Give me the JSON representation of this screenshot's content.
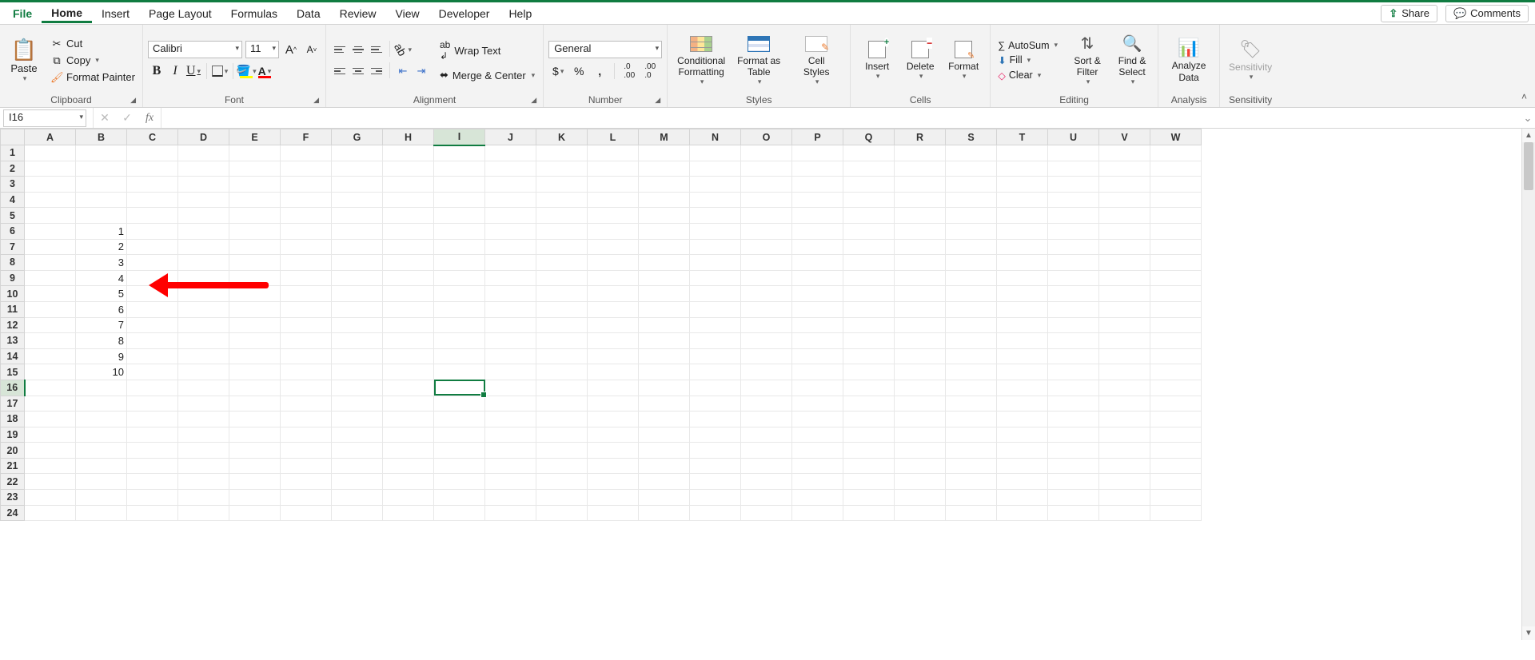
{
  "menu": {
    "tabs": [
      "File",
      "Home",
      "Insert",
      "Page Layout",
      "Formulas",
      "Data",
      "Review",
      "View",
      "Developer",
      "Help"
    ],
    "active": "Home",
    "share": "Share",
    "comments": "Comments"
  },
  "ribbon": {
    "clipboard": {
      "paste": "Paste",
      "cut": "Cut",
      "copy": "Copy",
      "painter": "Format Painter",
      "label": "Clipboard"
    },
    "font": {
      "name": "Calibri",
      "size": "11",
      "label": "Font"
    },
    "alignment": {
      "wrap": "Wrap Text",
      "merge": "Merge & Center",
      "label": "Alignment"
    },
    "number": {
      "format": "General",
      "label": "Number"
    },
    "styles": {
      "cf1": "Conditional",
      "cf2": "Formatting",
      "ft1": "Format as",
      "ft2": "Table",
      "cs1": "Cell",
      "cs2": "Styles",
      "label": "Styles"
    },
    "cells": {
      "insert": "Insert",
      "delete": "Delete",
      "format": "Format",
      "label": "Cells"
    },
    "editing": {
      "autosum": "AutoSum",
      "fill": "Fill",
      "clear": "Clear",
      "sort1": "Sort &",
      "sort2": "Filter",
      "find1": "Find &",
      "find2": "Select",
      "label": "Editing"
    },
    "analysis": {
      "btn1": "Analyze",
      "btn2": "Data",
      "label": "Analysis"
    },
    "sensitivity": {
      "btn": "Sensitivity",
      "label": "Sensitivity"
    }
  },
  "namebox": "I16",
  "grid": {
    "columns": [
      "A",
      "B",
      "C",
      "D",
      "E",
      "F",
      "G",
      "H",
      "I",
      "J",
      "K",
      "L",
      "M",
      "N",
      "O",
      "P",
      "Q",
      "R",
      "S",
      "T",
      "U",
      "V",
      "W"
    ],
    "rows": 24,
    "col_widths": {
      "default": 64,
      "B": 64
    },
    "selected": {
      "col": "I",
      "row": 16
    },
    "cells": {
      "B6": "1",
      "B7": "2",
      "B8": "3",
      "B9": "4",
      "B10": "5",
      "B11": "6",
      "B12": "7",
      "B13": "8",
      "B14": "9",
      "B15": "10"
    }
  }
}
